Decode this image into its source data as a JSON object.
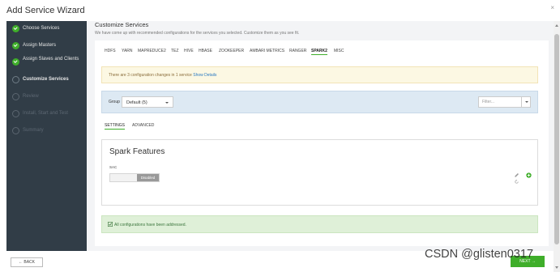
{
  "modal": {
    "title": "Add Service Wizard",
    "close": "×"
  },
  "sidebar": {
    "steps": [
      {
        "label": "Choose Services",
        "state": "done"
      },
      {
        "label": "Assign Masters",
        "state": "done"
      },
      {
        "label": "Assign Slaves and Clients",
        "state": "done"
      },
      {
        "label": "Customize Services",
        "state": "current",
        "number": "4"
      },
      {
        "label": "Review",
        "state": "future",
        "number": "5"
      },
      {
        "label": "Install, Start and Test",
        "state": "future",
        "number": "6"
      },
      {
        "label": "Summary",
        "state": "future",
        "number": "7"
      }
    ]
  },
  "main": {
    "title": "Customize Services",
    "description": "We have come up with recommended configurations for the services you selected. Customize them as you see fit.",
    "service_tabs": [
      "HDFS",
      "YARN",
      "MAPREDUCE2",
      "TEZ",
      "HIVE",
      "HBASE",
      "ZOOKEEPER",
      "AMBARI METRICS",
      "RANGER",
      "SPARK2",
      "MISC"
    ],
    "active_service_tab": "SPARK2",
    "warning": {
      "text": "There are 3 configuration changes in 1 service",
      "link": "Show Details"
    },
    "group": {
      "label": "Group",
      "value": "Default (5)"
    },
    "filter": {
      "placeholder": "Filter..."
    },
    "sub_tabs": [
      "SETTINGS",
      "ADVANCED"
    ],
    "active_sub_tab": "SETTINGS",
    "panel": {
      "title": "Spark Features",
      "field_label": "SAC",
      "toggle_value": "Disabled"
    },
    "success": "All configurations have been addressed."
  },
  "footer": {
    "back_label": "← BACK",
    "next_label": "NEXT →"
  },
  "watermark": "CSDN @glisten0317",
  "colors": {
    "accent": "#3fae2a",
    "sidebar_bg": "#313d47",
    "link": "#2a7ac2"
  }
}
